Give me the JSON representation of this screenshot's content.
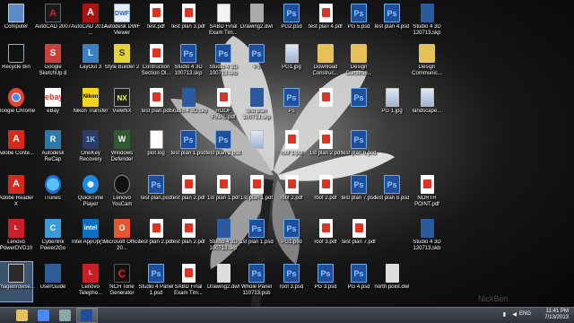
{
  "desktop": {
    "icons": [
      {
        "label": "Computer",
        "type": "computer",
        "icon": "computer-icon",
        "col": 0,
        "row": 0
      },
      {
        "label": "Recycle Bin",
        "type": "recycle",
        "icon": "recycle-bin-icon",
        "col": 0,
        "row": 1
      },
      {
        "label": "Google Chrome",
        "type": "chrome",
        "icon": "chrome-icon",
        "col": 0,
        "row": 2
      },
      {
        "label": "Adobe Conte...",
        "type": "adobe",
        "icon": "adobe-contribute-icon",
        "col": 0,
        "row": 3
      },
      {
        "label": "Adobe Reader X",
        "type": "adobe",
        "icon": "adobe-reader-icon",
        "col": 0,
        "row": 4
      },
      {
        "label": "Lenovo PowerDVD10",
        "type": "lenovo",
        "icon": "powerdvd-icon",
        "col": 0,
        "row": 5
      },
      {
        "label": "ImageBrowse...",
        "type": "imagebrowser",
        "icon": "image-browser-icon",
        "col": 0,
        "row": 6,
        "selected": true
      },
      {
        "label": "AutoCAD 2007",
        "type": "autocad",
        "icon": "autocad-icon",
        "col": 1,
        "row": 0
      },
      {
        "label": "Google SketchUp 8",
        "type": "sketchup",
        "icon": "sketchup-icon",
        "col": 1,
        "row": 1
      },
      {
        "label": "eBay",
        "type": "ebay",
        "icon": "ebay-icon",
        "col": 1,
        "row": 2
      },
      {
        "label": "Autodesk ReCap",
        "type": "recap",
        "icon": "recap-icon",
        "col": 1,
        "row": 3
      },
      {
        "label": "iTunes",
        "type": "itunes",
        "icon": "itunes-icon",
        "col": 1,
        "row": 4
      },
      {
        "label": "Cyberlink Power2Go",
        "type": "cyberlink",
        "icon": "cyberlink-icon",
        "col": 1,
        "row": 5
      },
      {
        "label": "UserGuide",
        "type": "userguide",
        "icon": "user-guide-icon",
        "col": 1,
        "row": 6
      },
      {
        "label": "AutoCAD 2014 - ...",
        "type": "autocad-red",
        "icon": "autocad-2014-icon",
        "col": 2,
        "row": 0
      },
      {
        "label": "LayOut 3",
        "type": "layout",
        "icon": "layout-icon",
        "col": 2,
        "row": 1
      },
      {
        "label": "Nikon Transfer",
        "type": "nikon",
        "icon": "nikon-icon",
        "col": 2,
        "row": 2
      },
      {
        "label": "OneKey Recovery",
        "type": "onekey",
        "icon": "onekey-icon",
        "col": 2,
        "row": 3
      },
      {
        "label": "QuickTime Player",
        "type": "quicktime",
        "icon": "quicktime-icon",
        "col": 2,
        "row": 4
      },
      {
        "label": "Intel AppUp(S...",
        "type": "intel",
        "icon": "intel-icon",
        "col": 2,
        "row": 5
      },
      {
        "label": "Lenovo Telepho...",
        "type": "lenovo",
        "icon": "lenovo-telephony-icon",
        "col": 2,
        "row": 6
      },
      {
        "label": "Autodesk DWF Viewer",
        "type": "dwf",
        "icon": "dwf-viewer-icon",
        "col": 3,
        "row": 0
      },
      {
        "label": "Style Builder 2",
        "type": "stylebuilder",
        "icon": "style-builder-icon",
        "col": 3,
        "row": 1
      },
      {
        "label": "ViewNX",
        "type": "viewnx",
        "icon": "viewnx-icon",
        "col": 3,
        "row": 2
      },
      {
        "label": "Windows Defender",
        "type": "defender",
        "icon": "defender-icon",
        "col": 3,
        "row": 3
      },
      {
        "label": "Lenovo YouCam",
        "type": "youcam",
        "icon": "youcam-icon",
        "col": 3,
        "row": 4
      },
      {
        "label": "Microsoft Office 20...",
        "type": "office",
        "icon": "office-icon",
        "col": 3,
        "row": 5
      },
      {
        "label": "NCH Tone Generator",
        "type": "nch",
        "icon": "nch-icon",
        "col": 3,
        "row": 6
      },
      {
        "label": "test.pdf",
        "type": "pdf",
        "icon": "pdf-file-icon",
        "col": 4,
        "row": 0
      },
      {
        "label": "Contruction Section Ol...",
        "type": "pdf",
        "icon": "pdf-file-icon",
        "col": 4,
        "row": 1
      },
      {
        "label": "test plan.pdf",
        "type": "pdf",
        "icon": "pdf-file-icon",
        "col": 4,
        "row": 2
      },
      {
        "label": "plot.log",
        "type": "log",
        "icon": "log-file-icon",
        "col": 4,
        "row": 3
      },
      {
        "label": "test plan.psd",
        "type": "psd",
        "icon": "psd-file-icon",
        "col": 4,
        "row": 4
      },
      {
        "label": "test plan 2.pdf",
        "type": "pdf",
        "icon": "pdf-file-icon",
        "col": 4,
        "row": 5
      },
      {
        "label": "Studio 4 Panel 1.psd",
        "type": "psd",
        "icon": "psd-file-icon",
        "col": 4,
        "row": 6
      },
      {
        "label": "test plan 3.pdf",
        "type": "pdf",
        "icon": "pdf-file-icon",
        "col": 5,
        "row": 0
      },
      {
        "label": "Studio 4 3D 100713.skp",
        "type": "psd",
        "icon": "psd-file-icon",
        "col": 5,
        "row": 1
      },
      {
        "label": "Studio 4 3D.skb",
        "type": "skp",
        "icon": "skp-file-icon",
        "col": 5,
        "row": 2
      },
      {
        "label": "test plan 1.psd",
        "type": "psd",
        "icon": "psd-file-icon",
        "col": 5,
        "row": 3
      },
      {
        "label": "test plan 2.pdf",
        "type": "pdf",
        "icon": "pdf-file-icon",
        "col": 5,
        "row": 4
      },
      {
        "label": "test plan 2.pdf",
        "type": "pdf",
        "icon": "pdf-file-icon",
        "col": 5,
        "row": 5
      },
      {
        "label": "SABD Final Exam Tim...",
        "type": "pdf",
        "icon": "pdf-file-icon",
        "col": 5,
        "row": 6
      },
      {
        "label": "SABD Final Exam Tim...",
        "type": "doc",
        "icon": "document-icon",
        "col": 6,
        "row": 0
      },
      {
        "label": "Studio 4 3D 100713.skb",
        "type": "psd",
        "icon": "psd-file-icon",
        "col": 6,
        "row": 1
      },
      {
        "label": "ROOF FINAL.pdf",
        "type": "pdf",
        "icon": "pdf-file-icon",
        "col": 6,
        "row": 2
      },
      {
        "label": "test plan 2.psd",
        "type": "psd",
        "icon": "psd-file-icon",
        "col": 6,
        "row": 3
      },
      {
        "label": "1st plan 1.pdf",
        "type": "pdf",
        "icon": "pdf-file-icon",
        "col": 6,
        "row": 4
      },
      {
        "label": "Studio 4 3D 100713.skp",
        "type": "skp",
        "icon": "skp-file-icon",
        "col": 6,
        "row": 5
      },
      {
        "label": "Drawing2.dwl",
        "type": "dwl",
        "icon": "dwl-file-icon",
        "col": 6,
        "row": 6
      },
      {
        "label": "Drawing2.dwl",
        "type": "blank",
        "icon": "file-icon",
        "col": 7,
        "row": 0
      },
      {
        "label": "Ps",
        "type": "psd",
        "icon": "psd-file-icon",
        "col": 7,
        "row": 1
      },
      {
        "label": "test plan 100713.skp",
        "type": "skp",
        "icon": "skp-file-icon",
        "col": 7,
        "row": 2
      },
      {
        "label": "",
        "type": "jpg",
        "icon": "image-file-icon",
        "col": 7,
        "row": 3
      },
      {
        "label": "1st plan 1.pdf",
        "type": "pdf",
        "icon": "pdf-file-icon",
        "col": 7,
        "row": 4
      },
      {
        "label": "1st plan 1.psd",
        "type": "psd",
        "icon": "psd-file-icon",
        "col": 7,
        "row": 5
      },
      {
        "label": "Whole Panel 110713.psb",
        "type": "psd",
        "icon": "psb-file-icon",
        "col": 7,
        "row": 6
      },
      {
        "label": "PG2.psd",
        "type": "psd",
        "icon": "psd-file-icon",
        "col": 8,
        "row": 0
      },
      {
        "label": "PG1.jpg",
        "type": "jpg",
        "icon": "image-file-icon",
        "col": 8,
        "row": 1
      },
      {
        "label": "Ps",
        "type": "psd",
        "icon": "psd-file-icon",
        "col": 8,
        "row": 2
      },
      {
        "label": "roof 1.pdf",
        "type": "pdf",
        "icon": "pdf-file-icon",
        "col": 8,
        "row": 3
      },
      {
        "label": "roof 2.pdf",
        "type": "pdf",
        "icon": "pdf-file-icon",
        "col": 8,
        "row": 4
      },
      {
        "label": "PG1.psd",
        "type": "psd",
        "icon": "psd-file-icon",
        "col": 8,
        "row": 5
      },
      {
        "label": "roof 3.psd",
        "type": "psd",
        "icon": "psd-file-icon",
        "col": 8,
        "row": 6
      },
      {
        "label": "test plan 4.pdf",
        "type": "pdf",
        "icon": "pdf-file-icon",
        "col": 9,
        "row": 0
      },
      {
        "label": "Download Construc...",
        "type": "folder",
        "icon": "folder-icon",
        "col": 9,
        "row": 1
      },
      {
        "label": "",
        "type": "pdf",
        "icon": "pdf-file-icon",
        "col": 9,
        "row": 2
      },
      {
        "label": "1st plan 2.pdf",
        "type": "pdf",
        "icon": "pdf-file-icon",
        "col": 9,
        "row": 3
      },
      {
        "label": "roof 2.pdf",
        "type": "pdf",
        "icon": "pdf-file-icon",
        "col": 9,
        "row": 4
      },
      {
        "label": "roof 3.pdf",
        "type": "pdf",
        "icon": "pdf-file-icon",
        "col": 9,
        "row": 5
      },
      {
        "label": "PG 3.psd",
        "type": "psd",
        "icon": "psd-file-icon",
        "col": 9,
        "row": 6
      },
      {
        "label": "PG 5.psd",
        "type": "psd",
        "icon": "psd-file-icon",
        "col": 10,
        "row": 0
      },
      {
        "label": "Design Construc...",
        "type": "folder",
        "icon": "folder-icon",
        "col": 10,
        "row": 1
      },
      {
        "label": "",
        "type": "psd",
        "icon": "psd-file-icon",
        "col": 10,
        "row": 2
      },
      {
        "label": "test plan 6.psd",
        "type": "psd",
        "icon": "psd-file-icon",
        "col": 10,
        "row": 3
      },
      {
        "label": "test plan 7.psd",
        "type": "psd",
        "icon": "psd-file-icon",
        "col": 10,
        "row": 4
      },
      {
        "label": "test plan 7.pdf",
        "type": "pdf",
        "icon": "pdf-file-icon",
        "col": 10,
        "row": 5
      },
      {
        "label": "PG 4.psd",
        "type": "psd",
        "icon": "psd-file-icon",
        "col": 10,
        "row": 6
      },
      {
        "label": "test plan 4.psd",
        "type": "psd",
        "icon": "psd-file-icon",
        "col": 11,
        "row": 0
      },
      {
        "label": "PG 1.jpg",
        "type": "jpg",
        "icon": "image-file-icon",
        "col": 11,
        "row": 2
      },
      {
        "label": "test plan 8.psd",
        "type": "psd",
        "icon": "psd-file-icon",
        "col": 11,
        "row": 4
      },
      {
        "label": "north point.dwl",
        "type": "dwl",
        "icon": "dwl-file-icon",
        "col": 11,
        "row": 6
      },
      {
        "label": "Studio 4 3D 120713.skp",
        "type": "skp",
        "icon": "skp-file-icon",
        "col": 12,
        "row": 0
      },
      {
        "label": "Design Communic...",
        "type": "folder",
        "icon": "folder-icon",
        "col": 12,
        "row": 1
      },
      {
        "label": "landscape...",
        "type": "jpg",
        "icon": "image-file-icon",
        "col": 12,
        "row": 2
      },
      {
        "label": "NORTH POINT.pdf",
        "type": "pdf",
        "icon": "pdf-file-icon",
        "col": 12,
        "row": 4
      },
      {
        "label": "Studio 4 3D 120713.skb",
        "type": "skp",
        "icon": "skp-file-icon",
        "col": 12,
        "row": 5
      }
    ]
  },
  "taskbar": {
    "buttons": [
      {
        "name": "file-explorer-icon",
        "color": "#e6c15a",
        "active": false
      },
      {
        "name": "chrome-icon",
        "color": "#4a8af4",
        "active": false
      },
      {
        "name": "calculator-icon",
        "color": "#8aa",
        "active": false
      },
      {
        "name": "photoshop-icon",
        "color": "#1f4f9c",
        "active": true
      }
    ],
    "language": "ENG",
    "time": "11:41 PM",
    "date": "7/13/2013"
  },
  "watermark": "NickBen"
}
